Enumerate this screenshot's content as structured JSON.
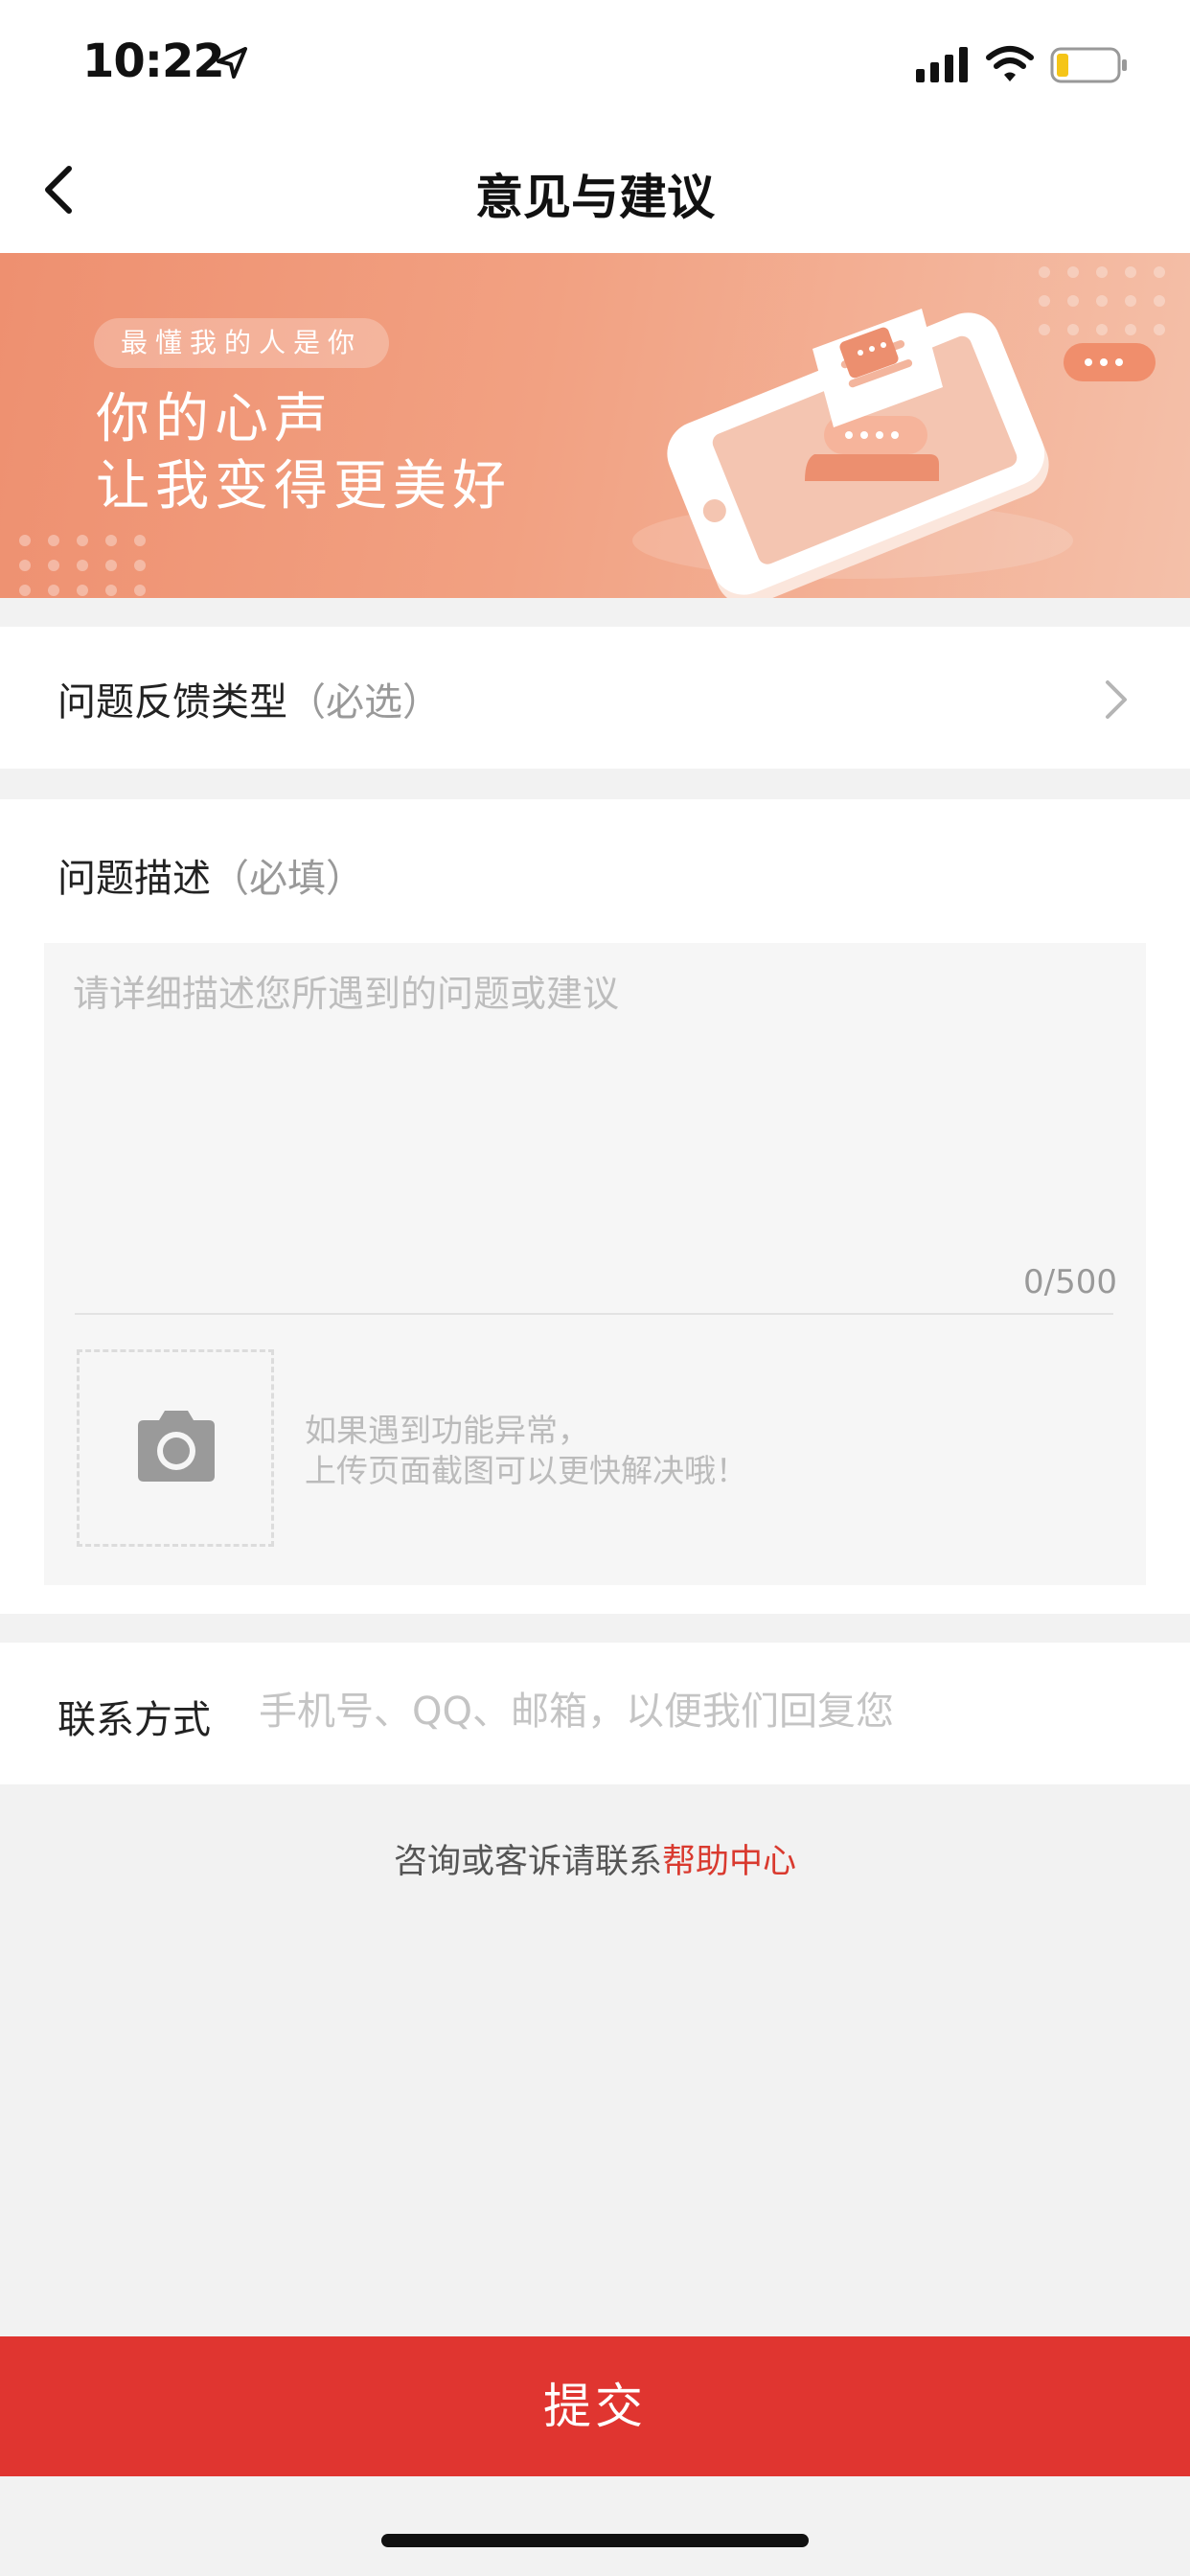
{
  "status_bar": {
    "time": "10:22"
  },
  "nav": {
    "title": "意见与建议"
  },
  "banner": {
    "pill": "最懂我的人是你",
    "line1": "你的心声",
    "line2": "让我变得更美好"
  },
  "feedback_type": {
    "label": "问题反馈类型",
    "hint": "（必选）"
  },
  "description": {
    "label": "问题描述",
    "hint": "（必填）",
    "placeholder": "请详细描述您所遇到的问题或建议",
    "counter": "0/500",
    "upload_tip_line1": "如果遇到功能异常，",
    "upload_tip_line2": "上传页面截图可以更快解决哦！"
  },
  "contact": {
    "label": "联系方式",
    "placeholder": "手机号、QQ、邮箱，以便我们回复您"
  },
  "help": {
    "prefix": "咨询或客诉请联系",
    "link": "帮助中心"
  },
  "submit": {
    "label": "提交"
  },
  "colors": {
    "accent": "#e03530",
    "link": "#d93a2f",
    "banner": "#f09a7a"
  },
  "icons": [
    "location-arrow-icon",
    "signal-icon",
    "wifi-icon",
    "battery-icon",
    "back-arrow-icon",
    "chevron-right-icon",
    "camera-icon"
  ]
}
